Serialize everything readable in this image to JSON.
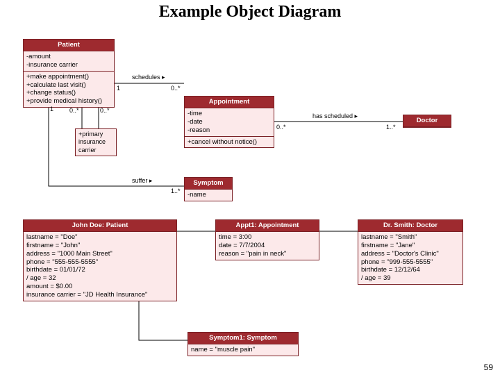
{
  "title": "Example Object Diagram",
  "pageNumber": "59",
  "classes": {
    "patient": {
      "name": "Patient",
      "attrs": "-amount\n-insurance carrier",
      "ops": "+make appointment()\n+calculate last visit()\n+change status()\n+provide medical history()"
    },
    "appointment": {
      "name": "Appointment",
      "attrs": "-time\n-date\n-reason",
      "ops": "+cancel without notice()"
    },
    "doctor": {
      "name": "Doctor"
    },
    "symptom": {
      "name": "Symptom",
      "attrs": "-name"
    },
    "insurance": {
      "label": "+primary\ninsurance\ncarrier"
    }
  },
  "assoc": {
    "schedules": "schedules ▸",
    "schedules_m1": "1",
    "schedules_m2": "0..*",
    "hasScheduled": "has scheduled ▸",
    "hasScheduled_m1": "0..*",
    "hasScheduled_m2": "1..*",
    "suffer": "suffer ▸",
    "suffer_m1": "1",
    "suffer_m2": "1..*",
    "primary_m1": "0..*",
    "primary_m2": "0..*"
  },
  "objects": {
    "johnDoe": {
      "name": "John Doe: Patient",
      "slots": "lastname = \"Doe\"\nfirstname = \"John\"\naddress = \"1000 Main Street\"\nphone = \"555-555-5555\"\nbirthdate = 01/01/72\n/ age = 32\namount = $0.00\ninsurance carrier = \"JD Health Insurance\""
    },
    "appt1": {
      "name": "Appt1: Appointment",
      "slots": "time = 3:00\ndate = 7/7/2004\nreason = \"pain in neck\""
    },
    "drSmith": {
      "name": "Dr. Smith: Doctor",
      "slots": "lastname = \"Smith\"\nfirstname = \"Jane\"\naddress = \"Doctor's Clinic\"\nphone = \"999-555-5555\"\nbirthdate = 12/12/64\n/ age = 39"
    },
    "symptom1": {
      "name": "Symptom1: Symptom",
      "slots": "name = \"muscle pain\""
    }
  }
}
